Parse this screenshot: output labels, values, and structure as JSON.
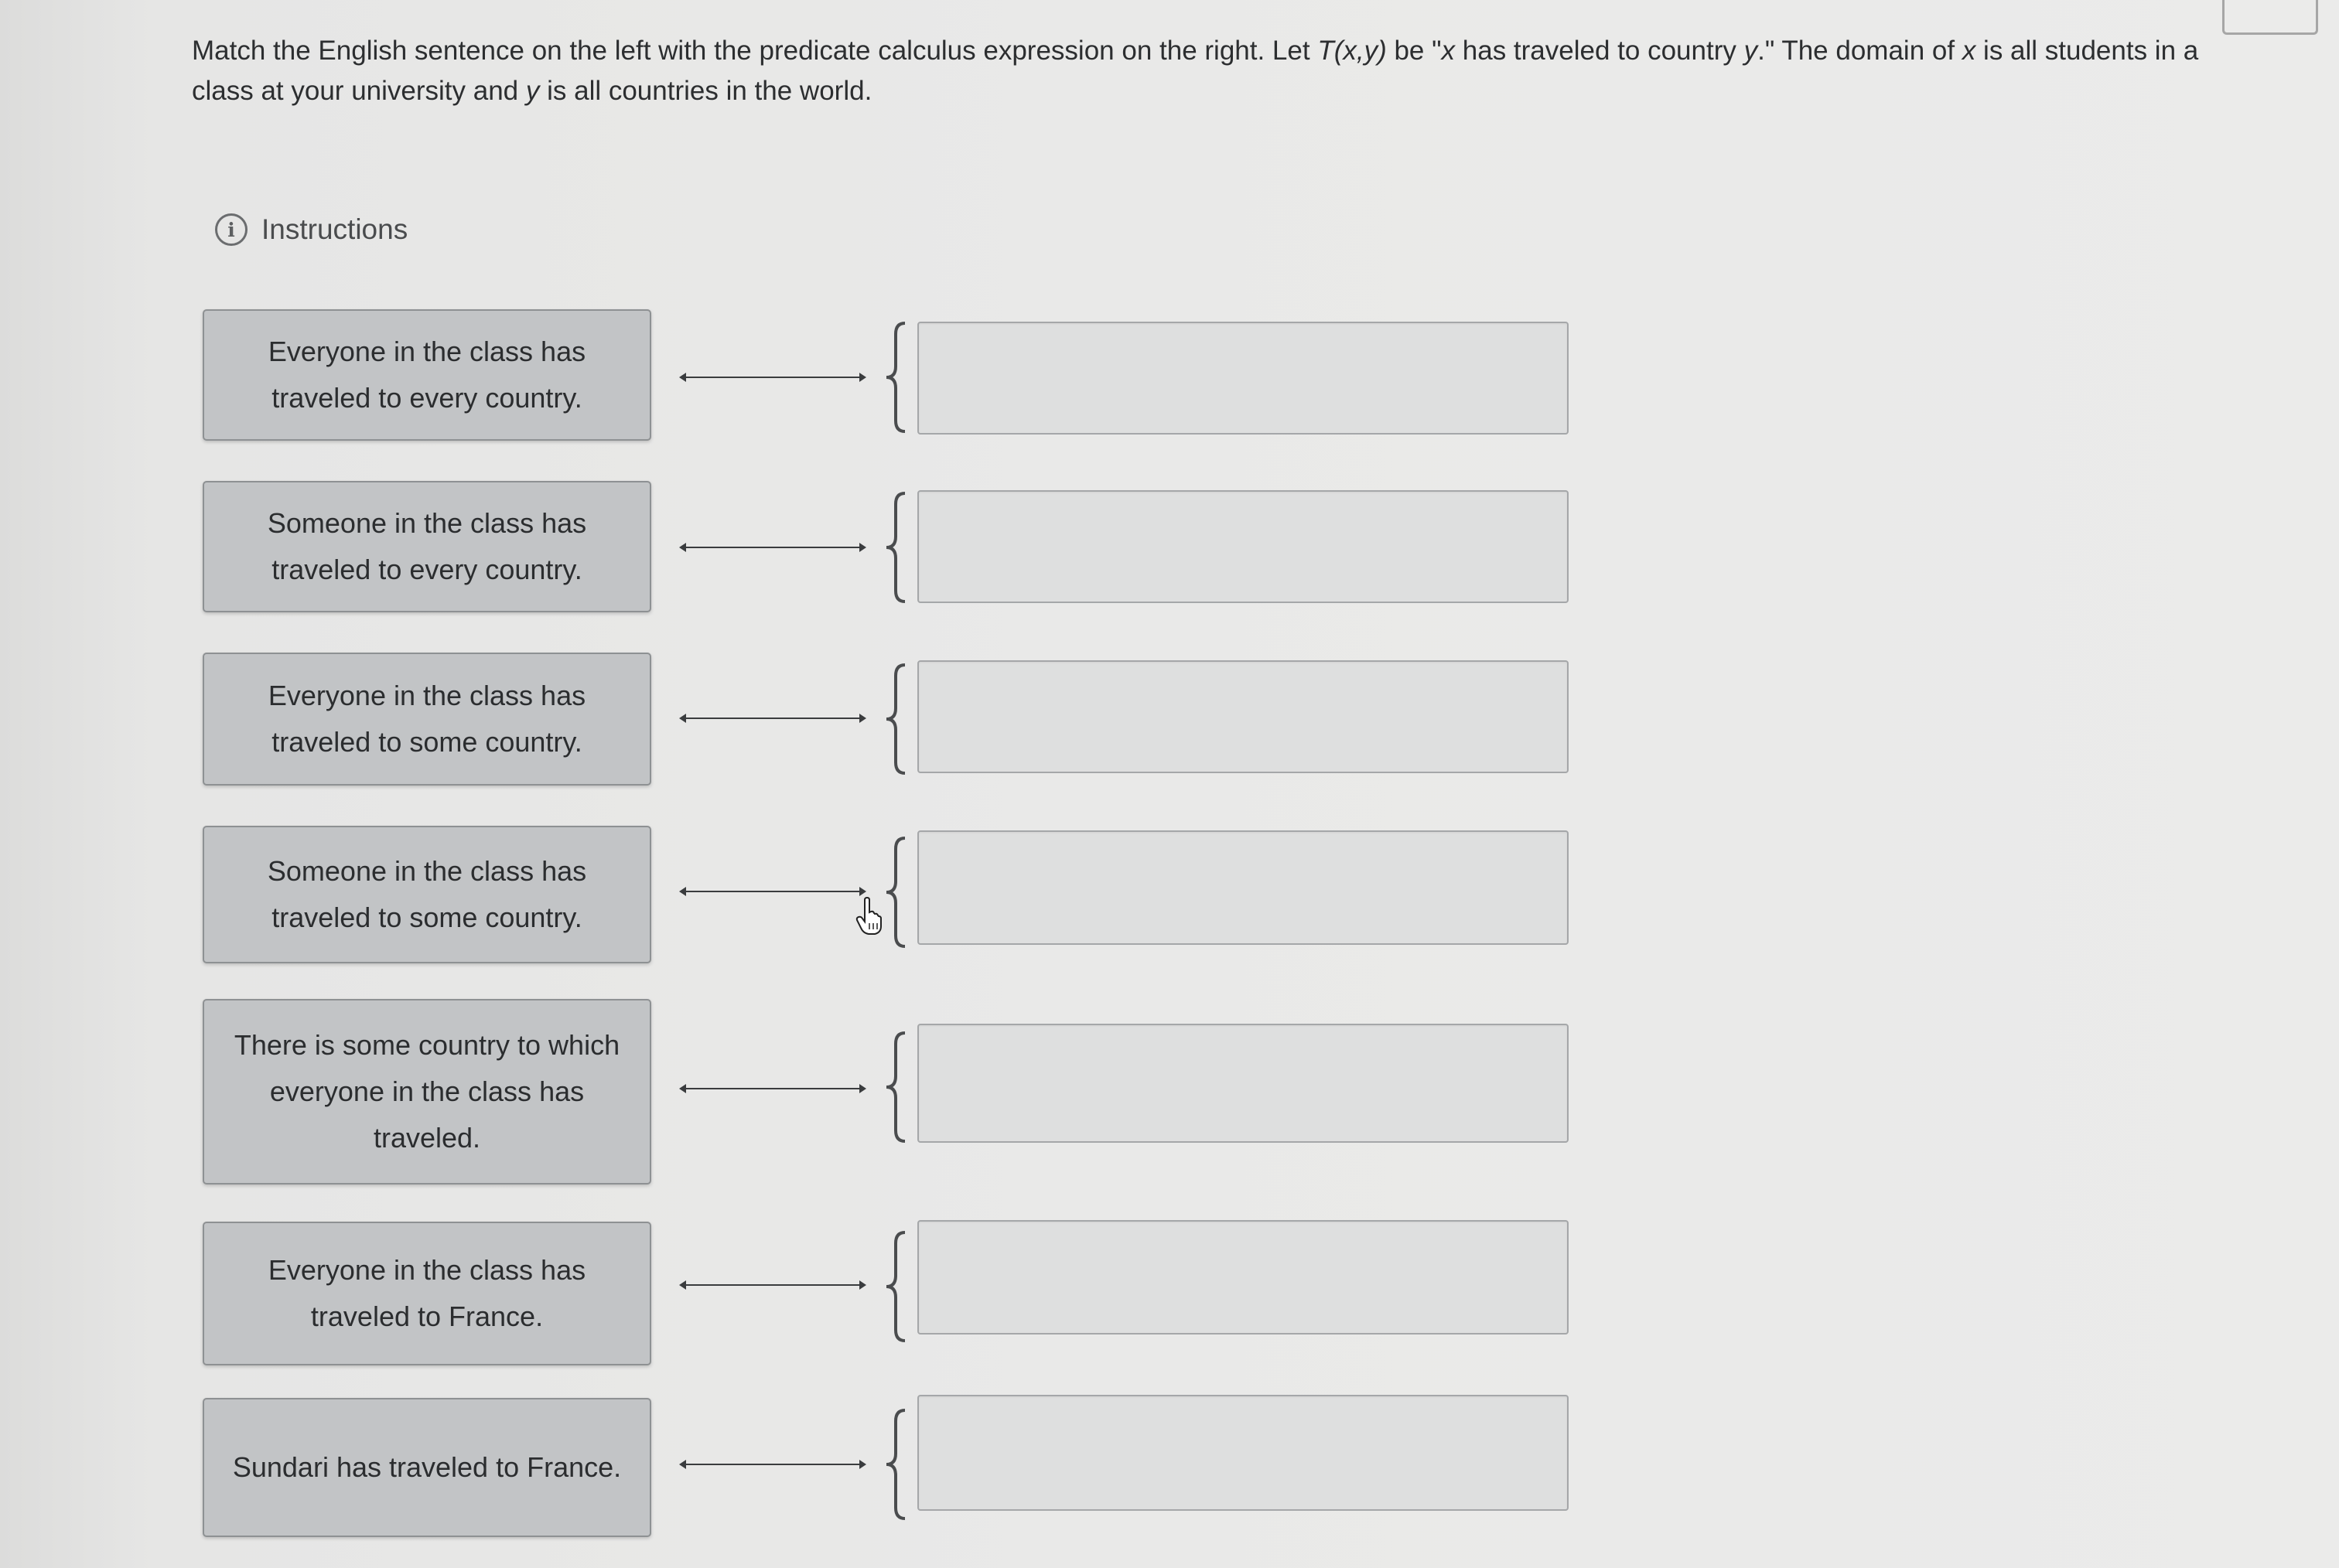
{
  "prompt": {
    "p1": "Match the English sentence on the left with the predicate calculus expression on the right. Let ",
    "t_expr": "T(x,y)",
    "p2": " be \"",
    "x1": "x",
    "p3": " has traveled to country ",
    "y1": "y",
    "p4": ".\" The domain of ",
    "x2": "x",
    "p5": " is all students in a class at your university and ",
    "y2": "y",
    "p6": " is all countries in the world."
  },
  "instructions": {
    "icon": "info-icon",
    "icon_glyph": "i",
    "label": "Instructions"
  },
  "items": [
    {
      "sentence": "Everyone in the class has traveled to every country."
    },
    {
      "sentence": "Someone in the class has traveled to every country."
    },
    {
      "sentence": "Everyone in the class has traveled to some country."
    },
    {
      "sentence": "Someone in the class has traveled to some country."
    },
    {
      "sentence": "There is some country to which everyone in the class has traveled."
    },
    {
      "sentence": "Everyone in the class has traveled to France."
    },
    {
      "sentence": "Sundari has traveled to France."
    }
  ],
  "colors": {
    "card_bg": "#c2c4c6",
    "target_bg": "#dedfdf",
    "text": "#2c2e30"
  }
}
